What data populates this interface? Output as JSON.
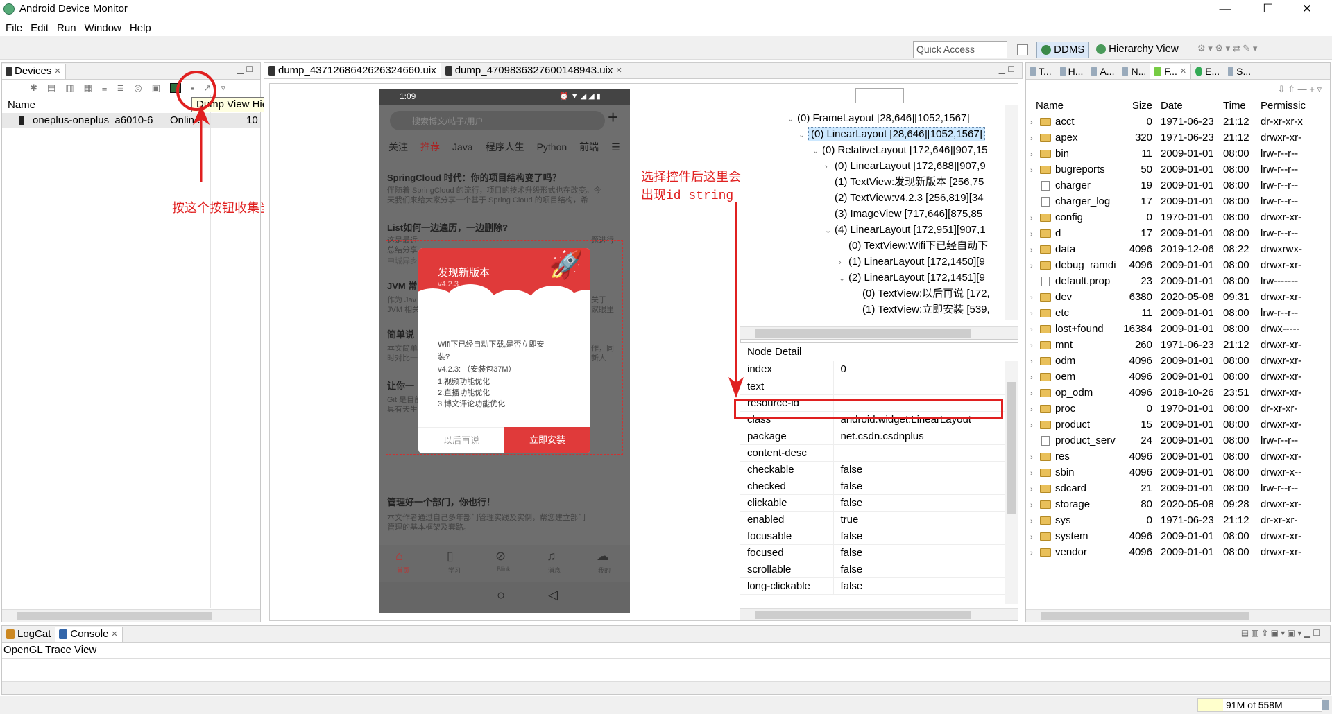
{
  "window": {
    "title": "Android Device Monitor",
    "minimize": "—",
    "maximize": "☐",
    "close": "✕"
  },
  "menu": [
    "File",
    "Edit",
    "Run",
    "Window",
    "Help"
  ],
  "toolbar": {
    "quick_access": "Quick Access",
    "ddms": "DDMS",
    "hierarchy": "Hierarchy View"
  },
  "devices": {
    "tab": "Devices",
    "col_name": "Name",
    "row_name": "oneplus-oneplus_a6010-6",
    "row_status": "Online",
    "row_api": "10",
    "tooltip": "Dump View Hierarchy for UI Automator"
  },
  "editor": {
    "tab1": "dump_4371268642626324660.uix",
    "tab2": "dump_4709836327600148943.uix"
  },
  "annotations": {
    "left": "按这个按钮收集当前界面View tree",
    "right_line1": "选择控件后这里会",
    "right_line2": "出现id string"
  },
  "phone": {
    "time": "1:09",
    "search": "搜索博文/帖子/用户",
    "tabs": [
      "关注",
      "推荐",
      "Java",
      "程序人生",
      "Python",
      "前端"
    ],
    "a1_title": "SpringCloud 时代：你的项目结构变了吗？",
    "a1_body1": "伴随着 SpringCloud 的流行，项目的技术升级形式也在改变。今",
    "a1_body2": "天我们来给大家分享一个基于 Spring Cloud 的项目结构，希",
    "a2_title": "List如何一边遍历，一边删除?",
    "a2_body1": "这是最近",
    "a2_body2": "总结分享",
    "a2_body3": "申城异乡",
    "a2_r1": "题进行",
    "a3_title": "JVM 常",
    "a3_body1": "作为 Jav",
    "a3_body2": "JVM 相关",
    "a3_r1": "关于",
    "a3_r2": "家眼里",
    "a4_title": "简单说",
    "a4_body1": "本文简单",
    "a4_body2": "时对比一",
    "a4_r1": "作，同",
    "a4_r2": "新人",
    "a5_title": "让你一",
    "a5_body1": "Git 是目前世界上最先进的版本控制软件，分布式架构使得其",
    "a5_body2": "具有天生安全性高的优点，加上其权限管理更加精确，使得",
    "a6_title": "管理好一个部门，你也行！",
    "a6_body1": "本文作者通过自己多年部门管理实践及实例，帮您建立部门",
    "a6_body2": "管理的基本框架及套路。",
    "bottom": [
      "首页",
      "学习",
      "Blink",
      "消息",
      "我的"
    ],
    "dialog": {
      "title": "发现新版本",
      "version": "v4.2.3",
      "l1": "Wifi下已经自动下载,是否立即安",
      "l2": "装?",
      "l3": "v4.2.3:  （安装包37M）",
      "l4": "1.视频功能优化",
      "l5": "2.直播功能优化",
      "l6": "3.博文评论功能优化",
      "later": "以后再说",
      "install": "立即安装"
    }
  },
  "tree": [
    "(0) FrameLayout [28,646][1052,1567]",
    "(0) LinearLayout [28,646][1052,1567]",
    "(0) RelativeLayout [172,646][907,15",
    "(0) LinearLayout [172,688][907,9",
    "(1) TextView:发现新版本 [256,75",
    "(2) TextView:v4.2.3 [256,819][34",
    "(3) ImageView [717,646][875,85",
    "(4) LinearLayout [172,951][907,1",
    "(0) TextView:Wifi下已经自动下",
    "(1) LinearLayout [172,1450][9",
    "(2) LinearLayout [172,1451][9",
    "(0) TextView:以后再说 [172,",
    "(1) TextView:立即安装 [539,"
  ],
  "node_detail": {
    "title": "Node Detail",
    "rows": [
      [
        "index",
        "0"
      ],
      [
        "text",
        ""
      ],
      [
        "resource-id",
        ""
      ],
      [
        "class",
        "android.widget.LinearLayout"
      ],
      [
        "package",
        "net.csdn.csdnplus"
      ],
      [
        "content-desc",
        ""
      ],
      [
        "checkable",
        "false"
      ],
      [
        "checked",
        "false"
      ],
      [
        "clickable",
        "false"
      ],
      [
        "enabled",
        "true"
      ],
      [
        "focusable",
        "false"
      ],
      [
        "focused",
        "false"
      ],
      [
        "scrollable",
        "false"
      ],
      [
        "long-clickable",
        "false"
      ]
    ]
  },
  "file_explorer": {
    "tabs": [
      "T...",
      "H...",
      "A...",
      "N...",
      "F...",
      "E...",
      "S..."
    ],
    "headers": [
      "Name",
      "Size",
      "Date",
      "Time",
      "Permissic"
    ],
    "rows": [
      [
        "acct",
        "0",
        "1971-06-23",
        "21:12",
        "dr-xr-xr-x",
        "d"
      ],
      [
        "apex",
        "320",
        "1971-06-23",
        "21:12",
        "drwxr-xr-",
        "d"
      ],
      [
        "bin",
        "11",
        "2009-01-01",
        "08:00",
        "lrw-r--r--",
        "d"
      ],
      [
        "bugreports",
        "50",
        "2009-01-01",
        "08:00",
        "lrw-r--r--",
        "d"
      ],
      [
        "charger",
        "19",
        "2009-01-01",
        "08:00",
        "lrw-r--r--",
        "f"
      ],
      [
        "charger_log",
        "17",
        "2009-01-01",
        "08:00",
        "lrw-r--r--",
        "f"
      ],
      [
        "config",
        "0",
        "1970-01-01",
        "08:00",
        "drwxr-xr-",
        "d"
      ],
      [
        "d",
        "17",
        "2009-01-01",
        "08:00",
        "lrw-r--r--",
        "d"
      ],
      [
        "data",
        "4096",
        "2019-12-06",
        "08:22",
        "drwxrwx-",
        "d"
      ],
      [
        "debug_ramdi",
        "4096",
        "2009-01-01",
        "08:00",
        "drwxr-xr-",
        "d"
      ],
      [
        "default.prop",
        "23",
        "2009-01-01",
        "08:00",
        "lrw-------",
        "f"
      ],
      [
        "dev",
        "6380",
        "2020-05-08",
        "09:31",
        "drwxr-xr-",
        "d"
      ],
      [
        "etc",
        "11",
        "2009-01-01",
        "08:00",
        "lrw-r--r--",
        "d"
      ],
      [
        "lost+found",
        "16384",
        "2009-01-01",
        "08:00",
        "drwx-----",
        "d"
      ],
      [
        "mnt",
        "260",
        "1971-06-23",
        "21:12",
        "drwxr-xr-",
        "d"
      ],
      [
        "odm",
        "4096",
        "2009-01-01",
        "08:00",
        "drwxr-xr-",
        "d"
      ],
      [
        "oem",
        "4096",
        "2009-01-01",
        "08:00",
        "drwxr-xr-",
        "d"
      ],
      [
        "op_odm",
        "4096",
        "2018-10-26",
        "23:51",
        "drwxr-xr-",
        "d"
      ],
      [
        "proc",
        "0",
        "1970-01-01",
        "08:00",
        "dr-xr-xr-",
        "d"
      ],
      [
        "product",
        "15",
        "2009-01-01",
        "08:00",
        "drwxr-xr-",
        "d"
      ],
      [
        "product_serv",
        "24",
        "2009-01-01",
        "08:00",
        "lrw-r--r--",
        "f"
      ],
      [
        "res",
        "4096",
        "2009-01-01",
        "08:00",
        "drwxr-xr-",
        "d"
      ],
      [
        "sbin",
        "4096",
        "2009-01-01",
        "08:00",
        "drwxr-x--",
        "d"
      ],
      [
        "sdcard",
        "21",
        "2009-01-01",
        "08:00",
        "lrw-r--r--",
        "d"
      ],
      [
        "storage",
        "80",
        "2020-05-08",
        "09:28",
        "drwxr-xr-",
        "d"
      ],
      [
        "sys",
        "0",
        "1971-06-23",
        "21:12",
        "dr-xr-xr-",
        "d"
      ],
      [
        "system",
        "4096",
        "2009-01-01",
        "08:00",
        "drwxr-xr-",
        "d"
      ],
      [
        "vendor",
        "4096",
        "2009-01-01",
        "08:00",
        "drwxr-xr-",
        "d"
      ]
    ]
  },
  "console": {
    "tab_logcat": "LogCat",
    "tab_console": "Console",
    "label": "OpenGL Trace View"
  },
  "status": {
    "memory": "91M of 558M"
  },
  "colors": {
    "accent_red": "#e02020",
    "selection": "#cce8ff",
    "dialog_red": "#e03a3a"
  }
}
